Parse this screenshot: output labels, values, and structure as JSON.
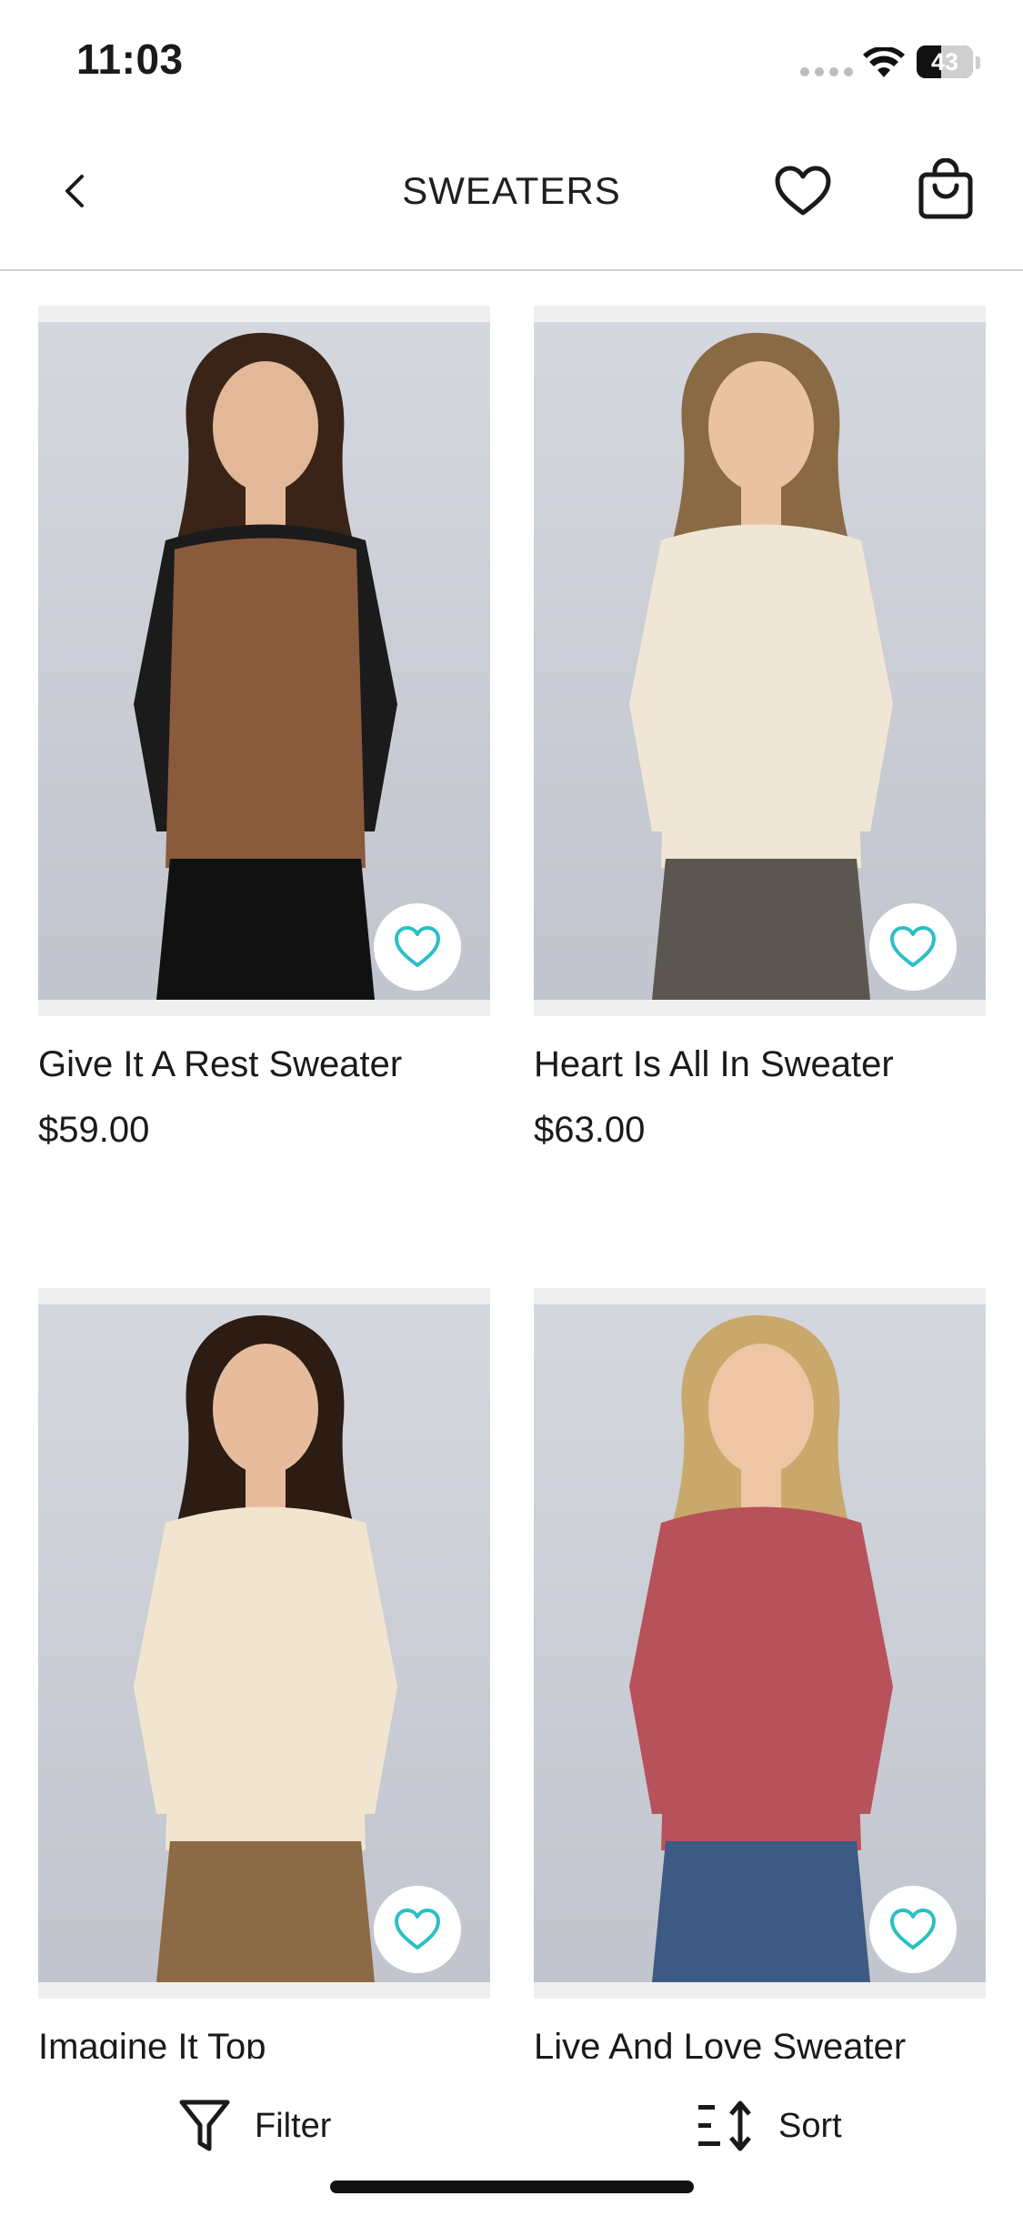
{
  "status": {
    "time": "11:03",
    "battery": "43",
    "battery_level": 0.43
  },
  "header": {
    "title": "SWEATERS"
  },
  "products": [
    {
      "name": "Give It A Rest Sweater",
      "price": "$59.00",
      "top_color": "#1b1b1b",
      "body_color": "#8a5a3c",
      "bottom_color": "#111111",
      "hair": "#3a2418",
      "skin": "#e2b899"
    },
    {
      "name": "Heart Is All In Sweater",
      "price": "$63.00",
      "top_color": "#efe6d6",
      "body_color": "#efe6d6",
      "bottom_color": "#5b564f",
      "hair": "#8a6a45",
      "skin": "#e9c2a2"
    },
    {
      "name": "Imagine It Top",
      "price": "",
      "top_color": "#f1e5cf",
      "body_color": "#f1e5cf",
      "bottom_color": "#8b6a45",
      "hair": "#2c1c14",
      "skin": "#e6bc9c"
    },
    {
      "name": "Live And Love Sweater",
      "price": "",
      "top_color": "#b8525a",
      "body_color": "#b8525a",
      "bottom_color": "#3d5a85",
      "hair": "#c9a86c",
      "skin": "#eec6a6"
    }
  ],
  "bottom_bar": {
    "filter_label": "Filter",
    "sort_label": "Sort"
  },
  "colors": {
    "accent": "#2bbfc6",
    "divider": "#cfcfcf"
  },
  "icons": {
    "back": "chevron-left-icon",
    "wishlist": "heart-outline-icon",
    "bag": "shopping-bag-icon",
    "filter": "funnel-icon",
    "sort": "sort-icon",
    "favorite": "heart-outline-icon"
  }
}
